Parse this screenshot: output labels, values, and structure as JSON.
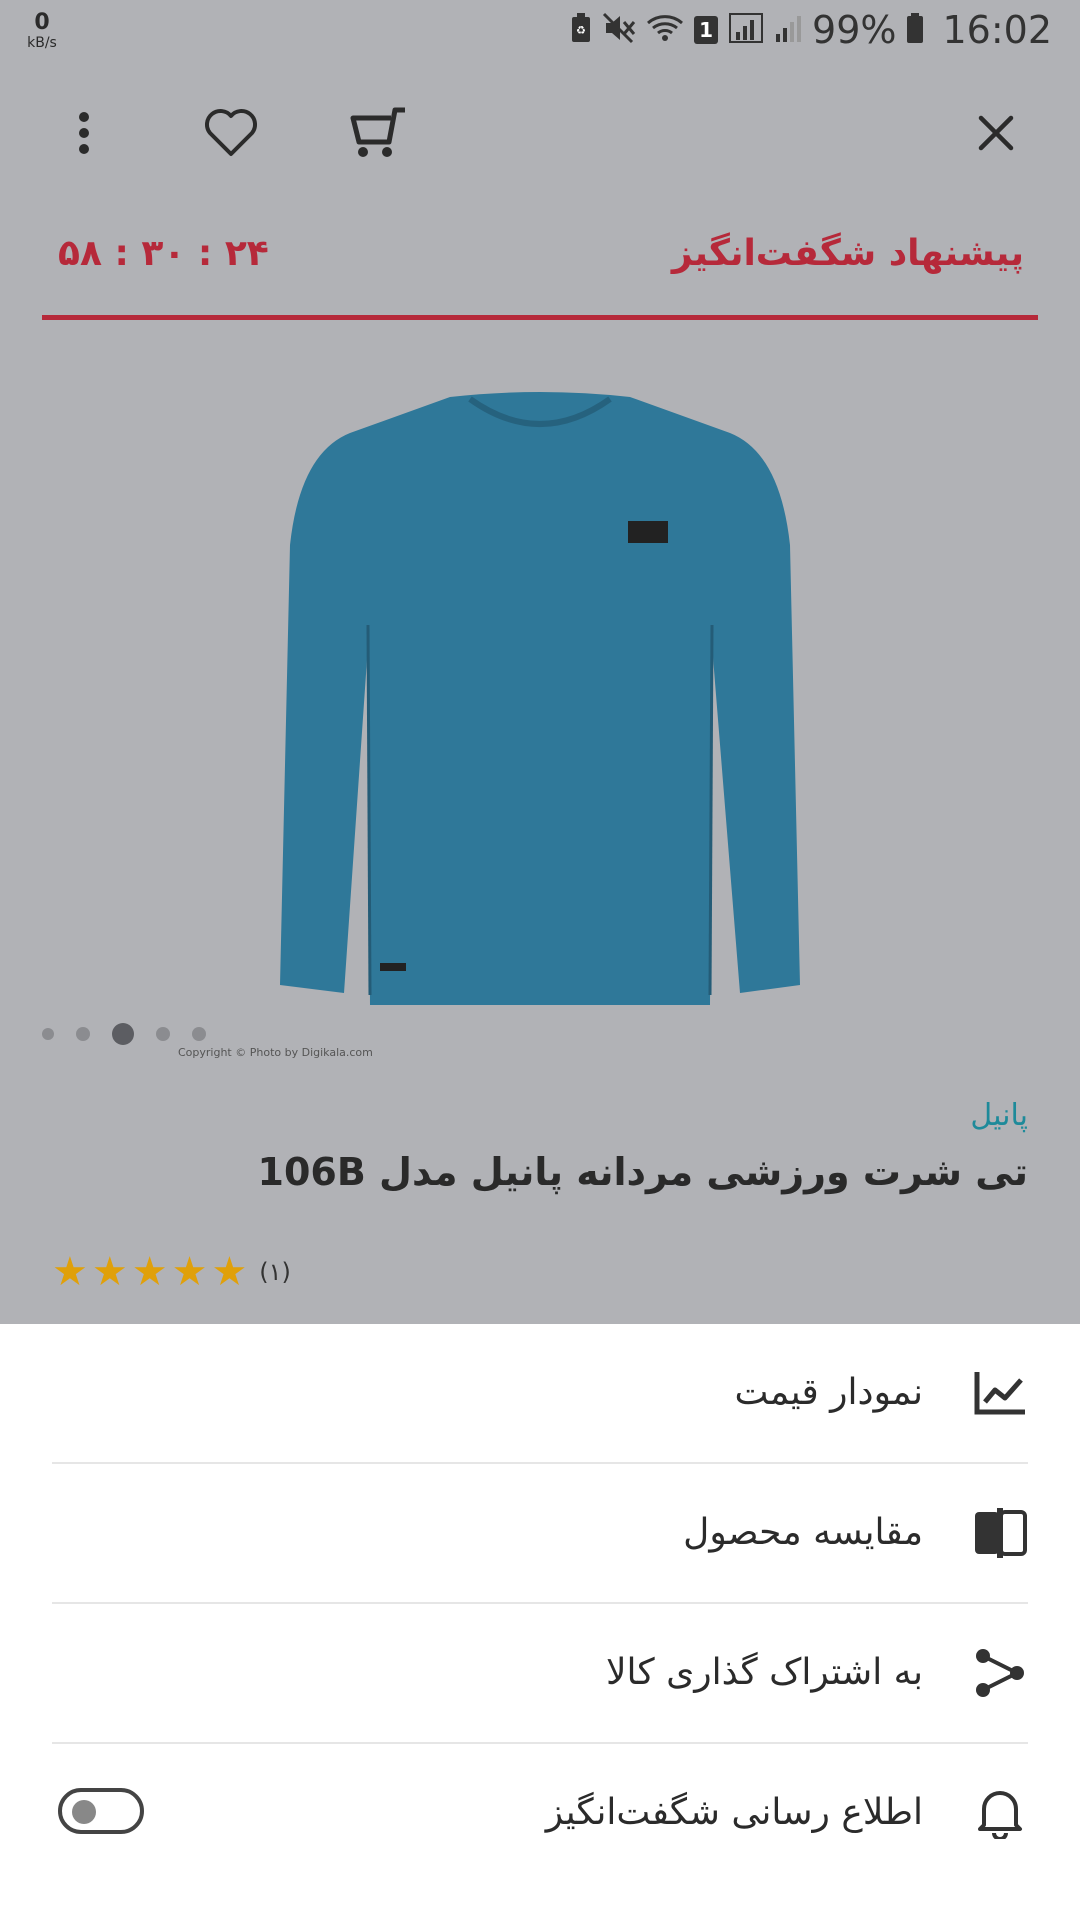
{
  "status_bar": {
    "speed_value": "0",
    "speed_unit": "kB/s",
    "sim_badge": "1",
    "battery_percent": "99%",
    "time": "16:02"
  },
  "toolbar": {
    "close_icon": "close-icon",
    "cart_icon": "cart-icon",
    "favorite_icon": "heart-icon",
    "more_icon": "more-vertical-icon"
  },
  "deal": {
    "title": "پیشنهاد شگفت‌انگیز",
    "timer": "۵۸ : ۳۰ : ۲۴"
  },
  "gallery": {
    "image_count": 5,
    "active_index": 2,
    "copyright": "Copyright © Photo by Digikala.com",
    "product_color": "#2f7899"
  },
  "product": {
    "brand": "پانیل",
    "title": "تی شرت ورزشی مردانه پانیل مدل 106B",
    "rating_stars": 5,
    "rating_count": "(۱)"
  },
  "menu": {
    "items": [
      {
        "label": "نمودار قیمت",
        "icon": "price-chart-icon"
      },
      {
        "label": "مقایسه محصول",
        "icon": "compare-icon"
      },
      {
        "label": "به اشتراک گذاری کالا",
        "icon": "share-icon"
      },
      {
        "label": "اطلاع رسانی شگفت‌انگیز",
        "icon": "bell-icon",
        "toggle": false
      }
    ]
  },
  "colors": {
    "accent_red": "#b6293a",
    "brand_teal": "#1e8a9a",
    "star_gold": "#e0a00a"
  }
}
